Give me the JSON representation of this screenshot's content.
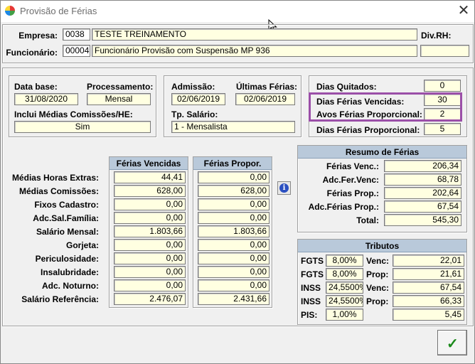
{
  "window": {
    "title": "Provisão de Férias"
  },
  "header": {
    "empresa_label": "Empresa:",
    "empresa_code": "0038",
    "empresa_name": "TESTE TREINAMENTO",
    "divrh_label": "Div.RH:",
    "divrh_value": "",
    "funcionario_label": "Funcionário:",
    "funcionario_code": "00004",
    "funcionario_name": "Funcionário Provisão com Suspensão MP 936"
  },
  "dates": {
    "data_base_label": "Data base:",
    "data_base": "31/08/2020",
    "processamento_label": "Processamento:",
    "processamento": "Mensal",
    "inclui_label": "Inclui Médias Comissões/HE:",
    "inclui": "Sim"
  },
  "admissao": {
    "admissao_label": "Admissão:",
    "admissao": "02/06/2019",
    "ultimas_label": "Últimas Férias:",
    "ultimas": "02/06/2019",
    "tp_salario_label": "Tp. Salário:",
    "tp_salario": "1 - Mensalista"
  },
  "dias": {
    "quitados_label": "Dias Quitados:",
    "quitados": "0",
    "vencidas_label": "Dias Férias Vencidas:",
    "vencidas": "30",
    "avos_label": "Avos Férias Proporcional:",
    "avos": "2",
    "proporcional_label": "Dias Férias Proporcional:",
    "proporcional": "5"
  },
  "medias": {
    "vencidas_header": "Férias Vencidas",
    "propor_header": "Férias Propor.",
    "rows": [
      {
        "label": "Médias Horas Extras:",
        "vencidas": "44,41",
        "propor": "0,00"
      },
      {
        "label": "Médias Comissões:",
        "vencidas": "628,00",
        "propor": "628,00"
      },
      {
        "label": "Fixos Cadastro:",
        "vencidas": "0,00",
        "propor": "0,00"
      },
      {
        "label": "Adc.Sal.Família:",
        "vencidas": "0,00",
        "propor": "0,00"
      },
      {
        "label": "Salário Mensal:",
        "vencidas": "1.803,66",
        "propor": "1.803,66"
      },
      {
        "label": "Gorjeta:",
        "vencidas": "0,00",
        "propor": "0,00"
      },
      {
        "label": "Periculosidade:",
        "vencidas": "0,00",
        "propor": "0,00"
      },
      {
        "label": "Insalubridade:",
        "vencidas": "0,00",
        "propor": "0,00"
      },
      {
        "label": "Adc. Noturno:",
        "vencidas": "0,00",
        "propor": "0,00"
      },
      {
        "label": "Salário Referência:",
        "vencidas": "2.476,07",
        "propor": "2.431,66"
      }
    ]
  },
  "resumo": {
    "header": "Resumo de Férias",
    "rows": [
      {
        "label": "Férias Venc.:",
        "value": "206,34"
      },
      {
        "label": "Adc.Fer.Venc:",
        "value": "68,78"
      },
      {
        "label": "Férias Prop.:",
        "value": "202,64"
      },
      {
        "label": "Adc.Férias Prop.:",
        "value": "67,54"
      },
      {
        "label": "Total:",
        "value": "545,30"
      }
    ]
  },
  "tributos": {
    "header": "Tributos",
    "rows": [
      {
        "label": "FGTS",
        "rate": "8,00%",
        "kind": "Venc:",
        "value": "22,01"
      },
      {
        "label": "FGTS",
        "rate": "8,00%",
        "kind": "Prop:",
        "value": "21,61"
      },
      {
        "label": "INSS",
        "rate": "24,5500%",
        "kind": "Venc:",
        "value": "67,54"
      },
      {
        "label": "INSS",
        "rate": "24,5500%",
        "kind": "Prop:",
        "value": "66,33"
      },
      {
        "label": "PIS:",
        "rate": "1,00%",
        "kind": "",
        "value": "5,45"
      }
    ]
  },
  "icons": {
    "info": "info-icon",
    "confirm": "checkmark-icon",
    "close": "close-icon"
  },
  "colors": {
    "field_bg": "#ffffe1",
    "header_bg": "#b9c9da",
    "highlight": "#9b4fa8"
  }
}
